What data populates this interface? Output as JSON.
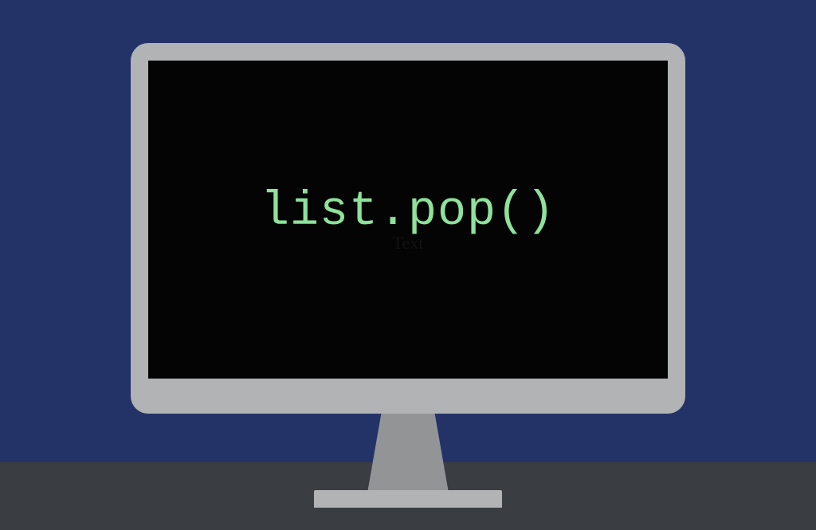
{
  "screen": {
    "code": "list.pop()",
    "placeholder": "Text"
  },
  "colors": {
    "background": "#243367",
    "desk": "#3a3d42",
    "monitor": "#b1b3b4",
    "stand_neck": "#929495",
    "screen_bg": "#040405",
    "code_color": "#8ee29a"
  }
}
